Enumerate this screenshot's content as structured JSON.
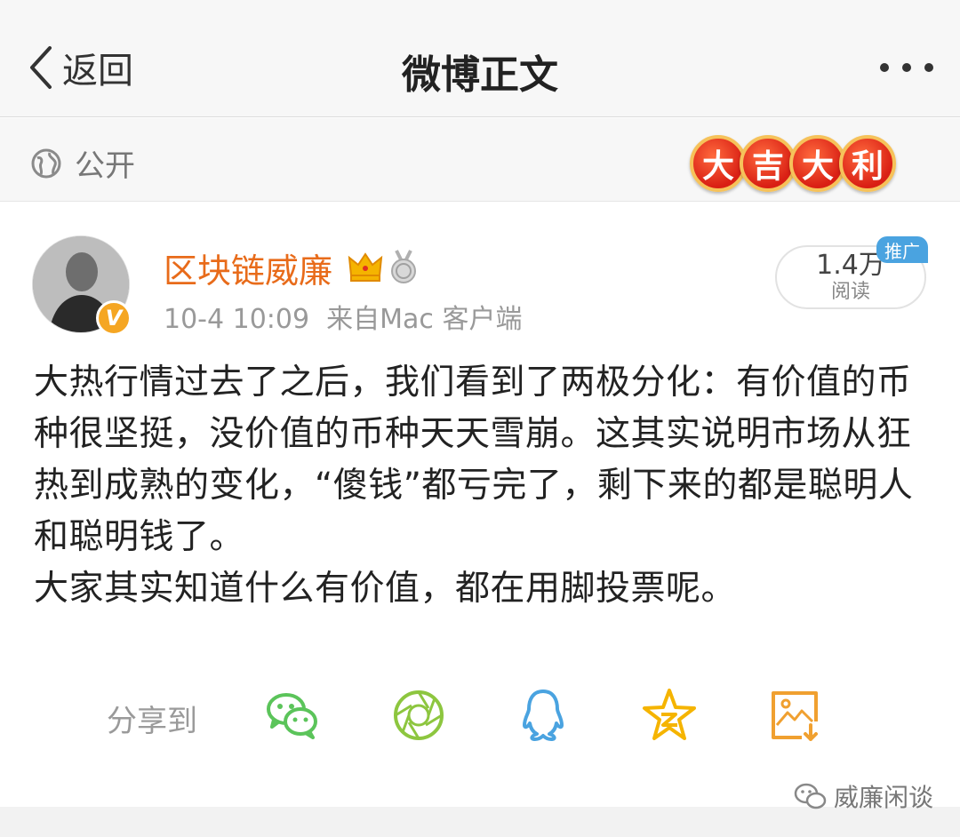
{
  "nav": {
    "back_label": "返回",
    "title": "微博正文",
    "more_icon": "more-dots-icon"
  },
  "visibility": {
    "icon": "globe-icon",
    "label": "公开"
  },
  "badge_chars": [
    "大",
    "吉",
    "大",
    "利"
  ],
  "post": {
    "author": "区块链威廉",
    "timestamp": "10-4 10:09",
    "source": "来自Mac 客户端",
    "reads_count": "1.4万",
    "reads_label": "阅读",
    "promo_tag": "推广",
    "paragraphs": [
      "大热行情过去了之后，我们看到了两极分化：有价值的币种很坚挺，没价值的币种天天雪崩。这其实说明市场从狂热到成熟的变化，“傻钱”都亏完了，剩下来的都是聪明人和聪明钱了。",
      "大家其实知道什么有价值，都在用脚投票呢。"
    ]
  },
  "share": {
    "label": "分享到",
    "targets": [
      {
        "icon": "wechat-icon",
        "color": "#5bc45a"
      },
      {
        "icon": "moments-icon",
        "color": "#8dc63f"
      },
      {
        "icon": "qq-icon",
        "color": "#4aa3e0"
      },
      {
        "icon": "qzone-icon",
        "color": "#f5b400"
      },
      {
        "icon": "save-image-icon",
        "color": "#f0a030"
      }
    ]
  },
  "watermark": {
    "text": "威廉闲谈"
  }
}
